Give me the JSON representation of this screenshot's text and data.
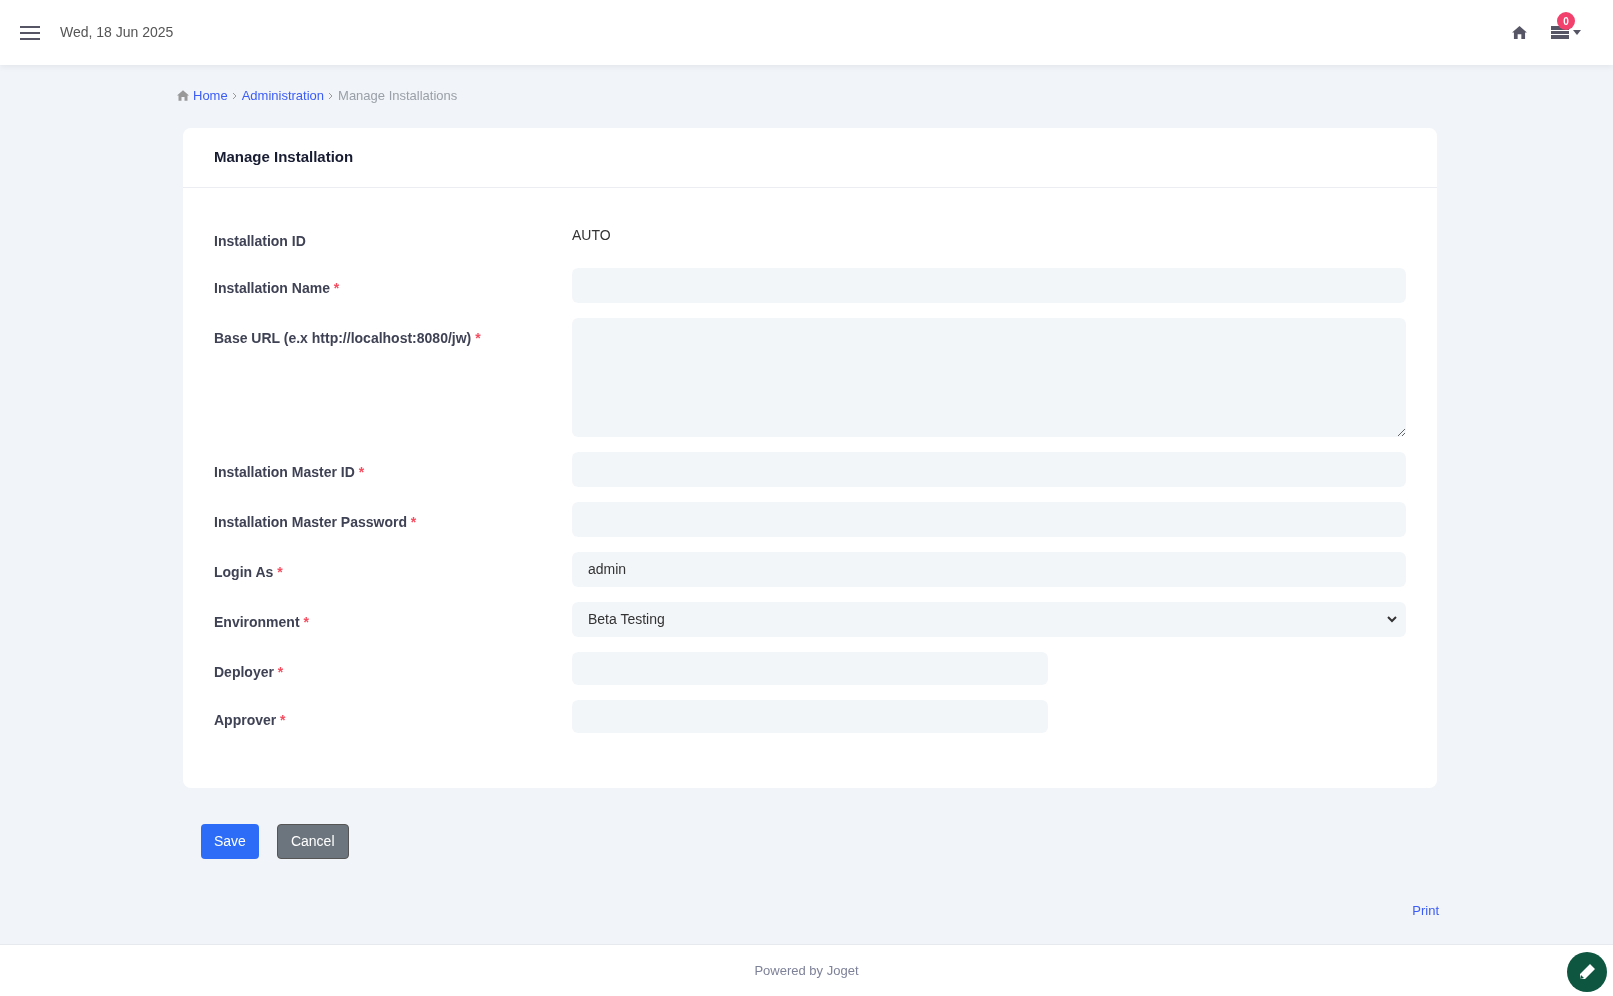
{
  "header": {
    "date": "Wed, 18 Jun 2025",
    "notification_count": "0"
  },
  "breadcrumb": [
    {
      "label": "Home",
      "link": true
    },
    {
      "label": "Administration",
      "link": true
    },
    {
      "label": "Manage Installations",
      "link": false
    }
  ],
  "form": {
    "title": "Manage Installation",
    "fields": [
      {
        "kind": "static",
        "label": "Installation ID",
        "value": "AUTO"
      },
      {
        "kind": "text",
        "label": "Installation Name",
        "required_mark": "*"
      },
      {
        "kind": "textarea",
        "label": "Base URL (e.x http://localhost:8080/jw)",
        "required_mark": "*"
      },
      {
        "kind": "text",
        "label": "Installation Master ID",
        "required_mark": "*"
      },
      {
        "kind": "password",
        "label": "Installation Master Password",
        "required_mark": "*"
      },
      {
        "kind": "text",
        "label": "Login As",
        "required_mark": "*",
        "value": "admin"
      },
      {
        "kind": "select",
        "label": "Environment",
        "required_mark": "*",
        "value": "Beta Testing"
      },
      {
        "kind": "short",
        "label": "Deployer",
        "required_mark": "*"
      },
      {
        "kind": "short",
        "label": "Approver",
        "required_mark": "*"
      }
    ]
  },
  "buttons": [
    {
      "kind": "primary",
      "label": "Save"
    },
    {
      "kind": "secondary",
      "label": "Cancel"
    }
  ],
  "print_link": "Print",
  "footer": "Powered by Joget"
}
